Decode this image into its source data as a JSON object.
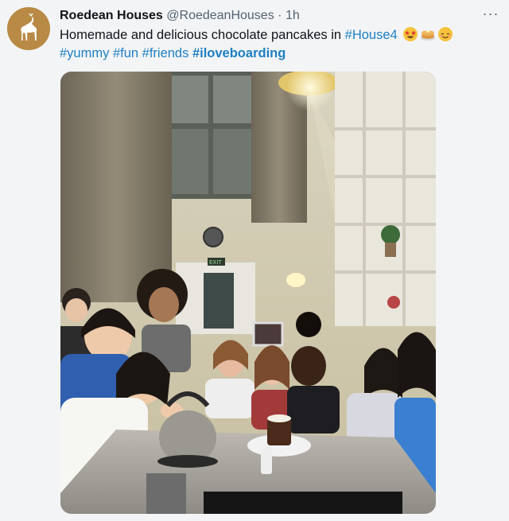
{
  "tweet": {
    "display_name": "Roedean Houses",
    "handle": "@RoedeanHouses",
    "separator": "·",
    "time": "1h",
    "more_label": "···",
    "text_prefix": "Homemade and delicious chocolate pancakes in ",
    "hashtags_line1": [
      "#House4"
    ],
    "hashtags_line2": [
      "#yummy",
      "#fun",
      "#friends",
      "#iloveboarding"
    ],
    "emojis": [
      "star-struck-emoji",
      "pancakes-emoji",
      "relieved-emoji"
    ],
    "colors": {
      "hashtag": "#1d7fc2",
      "avatar_bg": "#b88a45",
      "background": "#f3f4f6"
    }
  },
  "media": {
    "sign_text": "EXIT"
  }
}
